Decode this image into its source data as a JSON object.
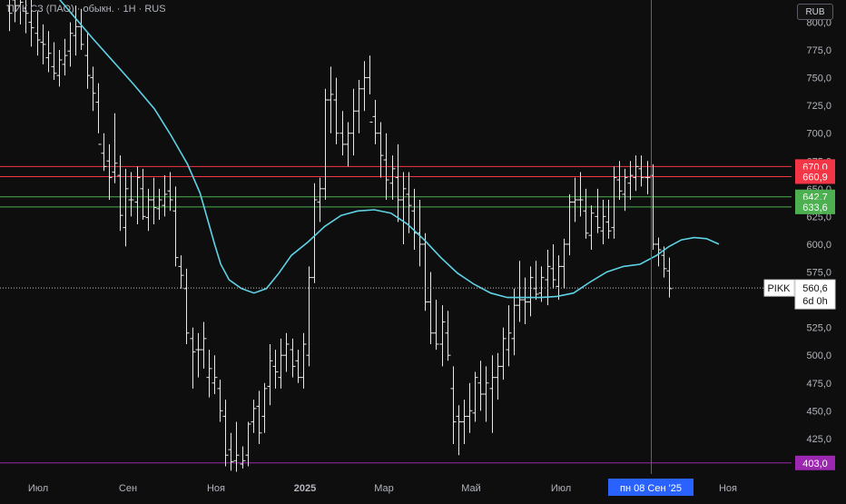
{
  "header": {
    "title": "ПИК СЗ (ПАО) · обыкн. · 1Н · RUS"
  },
  "currency": "RUB",
  "colors": {
    "background": "#0e0e0e",
    "bars": "#e8e8e8",
    "moving_average": "#5fd3e6",
    "resistance": "#f23645",
    "support": "#4caf50",
    "purple_level": "#9c27b0",
    "crosshair": "#3d5afe",
    "date_badge": "#2962ff"
  },
  "chart_data": {
    "type": "ohlc",
    "y_axis": {
      "range": [
        393,
        820
      ],
      "ticks": [
        800,
        775,
        750,
        725,
        700,
        675,
        650,
        625,
        600,
        575,
        550,
        525,
        500,
        475,
        450,
        425
      ],
      "tick_labels": [
        "800,0",
        "775,0",
        "750,0",
        "725,0",
        "700,0",
        "675,0",
        "650,0",
        "625,0",
        "600,0",
        "575,0",
        "550,0",
        "525,0",
        "500,0",
        "475,0",
        "450,0",
        "425,0"
      ]
    },
    "x_axis": {
      "labels": [
        "Июл",
        "Сен",
        "Ноя",
        "2025",
        "Мар",
        "Май",
        "Июл",
        "Ноя"
      ],
      "bold_label": "2025"
    },
    "symbol": "PIKK",
    "last_price": {
      "value": 560.6,
      "label": "560,6",
      "countdown": "6d 0h"
    },
    "crosshair_date": "пн 08 Сен '25",
    "horizontal_levels": [
      {
        "value": 824,
        "kind": "purple_level",
        "label": ""
      },
      {
        "value": 670.0,
        "kind": "resistance",
        "label": "670,0"
      },
      {
        "value": 660.9,
        "kind": "resistance",
        "label": "660,9"
      },
      {
        "value": 642.7,
        "kind": "support",
        "label": "642,7"
      },
      {
        "value": 633.6,
        "kind": "support",
        "label": "633,6"
      },
      {
        "value": 403.0,
        "kind": "purple_level",
        "label": "403,0"
      }
    ],
    "bars": [
      [
        815,
        832,
        792,
        808
      ],
      [
        820,
        832,
        800,
        815
      ],
      [
        815,
        830,
        798,
        818
      ],
      [
        810,
        825,
        790,
        808
      ],
      [
        800,
        820,
        778,
        795
      ],
      [
        790,
        810,
        770,
        784
      ],
      [
        782,
        798,
        762,
        780
      ],
      [
        768,
        792,
        755,
        772
      ],
      [
        760,
        782,
        748,
        754
      ],
      [
        752,
        775,
        742,
        766
      ],
      [
        762,
        785,
        752,
        770
      ],
      [
        774,
        800,
        760,
        790
      ],
      [
        788,
        815,
        770,
        796
      ],
      [
        796,
        812,
        775,
        780
      ],
      [
        770,
        790,
        740,
        752
      ],
      [
        750,
        760,
        720,
        736
      ],
      [
        728,
        745,
        700,
        690
      ],
      [
        682,
        700,
        666,
        670
      ],
      [
        675,
        690,
        640,
        660
      ],
      [
        665,
        718,
        655,
        673
      ],
      [
        662,
        680,
        612,
        626
      ],
      [
        615,
        668,
        598,
        650
      ],
      [
        640,
        665,
        625,
        640
      ],
      [
        638,
        670,
        618,
        660
      ],
      [
        650,
        668,
        622,
        625
      ],
      [
        624,
        650,
        612,
        640
      ],
      [
        640,
        660,
        618,
        633
      ],
      [
        632,
        650,
        622,
        640
      ],
      [
        635,
        662,
        625,
        645
      ],
      [
        648,
        665,
        630,
        640
      ],
      [
        630,
        652,
        580,
        588
      ],
      [
        580,
        590,
        560,
        572
      ],
      [
        560,
        578,
        510,
        520
      ],
      [
        515,
        525,
        470,
        503
      ],
      [
        505,
        520,
        480,
        505
      ],
      [
        505,
        530,
        488,
        515
      ],
      [
        480,
        505,
        462,
        488
      ],
      [
        475,
        500,
        465,
        480
      ],
      [
        470,
        478,
        440,
        450
      ],
      [
        445,
        460,
        400,
        410
      ],
      [
        415,
        430,
        396,
        404
      ],
      [
        405,
        440,
        395,
        410
      ],
      [
        402,
        418,
        398,
        405
      ],
      [
        410,
        440,
        400,
        438
      ],
      [
        440,
        460,
        430,
        452
      ],
      [
        454,
        468,
        420,
        430
      ],
      [
        445,
        475,
        430,
        470
      ],
      [
        472,
        510,
        455,
        495
      ],
      [
        490,
        505,
        470,
        485
      ],
      [
        480,
        515,
        470,
        500
      ],
      [
        500,
        520,
        485,
        510
      ],
      [
        505,
        515,
        480,
        490
      ],
      [
        495,
        505,
        475,
        480
      ],
      [
        480,
        520,
        470,
        510
      ],
      [
        500,
        580,
        490,
        570
      ],
      [
        570,
        655,
        565,
        640
      ],
      [
        638,
        660,
        620,
        650
      ],
      [
        650,
        740,
        640,
        730
      ],
      [
        730,
        760,
        700,
        735
      ],
      [
        730,
        750,
        690,
        700
      ],
      [
        700,
        720,
        680,
        690
      ],
      [
        690,
        710,
        670,
        700
      ],
      [
        700,
        740,
        680,
        720
      ],
      [
        720,
        748,
        700,
        740
      ],
      [
        740,
        765,
        720,
        750
      ],
      [
        750,
        770,
        735,
        710
      ],
      [
        715,
        730,
        690,
        700
      ],
      [
        700,
        710,
        660,
        680
      ],
      [
        676,
        700,
        640,
        658
      ],
      [
        655,
        680,
        640,
        668
      ],
      [
        660,
        690,
        620,
        640
      ],
      [
        640,
        665,
        600,
        650
      ],
      [
        645,
        665,
        610,
        635
      ],
      [
        630,
        650,
        595,
        610
      ],
      [
        610,
        640,
        580,
        600
      ],
      [
        600,
        610,
        540,
        548
      ],
      [
        548,
        575,
        510,
        520
      ],
      [
        520,
        550,
        505,
        510
      ],
      [
        510,
        545,
        490,
        530
      ],
      [
        520,
        540,
        495,
        500
      ],
      [
        470,
        490,
        420,
        440
      ],
      [
        445,
        455,
        410,
        440
      ],
      [
        440,
        460,
        420,
        445
      ],
      [
        445,
        475,
        430,
        450
      ],
      [
        448,
        485,
        440,
        480
      ],
      [
        475,
        495,
        450,
        465
      ],
      [
        465,
        490,
        440,
        475
      ],
      [
        470,
        500,
        430,
        480
      ],
      [
        480,
        502,
        460,
        490
      ],
      [
        490,
        525,
        478,
        515
      ],
      [
        505,
        545,
        490,
        520
      ],
      [
        515,
        560,
        500,
        545
      ],
      [
        545,
        585,
        530,
        550
      ],
      [
        550,
        570,
        528,
        548
      ],
      [
        548,
        580,
        535,
        570
      ],
      [
        560,
        585,
        550,
        555
      ],
      [
        556,
        580,
        548,
        570
      ],
      [
        568,
        595,
        545,
        580
      ],
      [
        578,
        600,
        560,
        568
      ],
      [
        562,
        590,
        550,
        580
      ],
      [
        580,
        605,
        560,
        600
      ],
      [
        600,
        645,
        590,
        638
      ],
      [
        638,
        660,
        620,
        640
      ],
      [
        640,
        665,
        625,
        640
      ],
      [
        630,
        650,
        605,
        610
      ],
      [
        608,
        635,
        595,
        628
      ],
      [
        625,
        650,
        610,
        615
      ],
      [
        612,
        640,
        600,
        625
      ],
      [
        620,
        640,
        605,
        612
      ],
      [
        615,
        670,
        605,
        660
      ],
      [
        658,
        675,
        640,
        648
      ],
      [
        645,
        668,
        630,
        660
      ],
      [
        655,
        675,
        640,
        662
      ],
      [
        660,
        680,
        648,
        670
      ],
      [
        668,
        680,
        652,
        660
      ],
      [
        660,
        675,
        645,
        660
      ],
      [
        662,
        672,
        595,
        600
      ],
      [
        600,
        606,
        580,
        595
      ],
      [
        590,
        598,
        570,
        578
      ],
      [
        576,
        588,
        552,
        560
      ]
    ],
    "moving_average": [
      [
        0,
        868
      ],
      [
        10,
        850
      ],
      [
        20,
        830
      ],
      [
        30,
        808
      ],
      [
        40,
        786
      ],
      [
        50,
        765
      ],
      [
        60,
        744
      ],
      [
        70,
        722
      ],
      [
        78,
        698
      ],
      [
        86,
        672
      ],
      [
        92,
        646
      ],
      [
        96,
        620
      ],
      [
        99,
        600
      ],
      [
        102,
        582
      ],
      [
        106,
        568
      ],
      [
        112,
        560
      ],
      [
        118,
        556
      ],
      [
        124,
        560
      ],
      [
        130,
        574
      ],
      [
        136,
        590
      ],
      [
        144,
        602
      ],
      [
        152,
        616
      ],
      [
        160,
        626
      ],
      [
        168,
        630
      ],
      [
        176,
        631
      ],
      [
        184,
        628
      ],
      [
        192,
        618
      ],
      [
        200,
        604
      ],
      [
        208,
        588
      ],
      [
        216,
        574
      ],
      [
        224,
        564
      ],
      [
        232,
        556
      ],
      [
        240,
        552
      ],
      [
        248,
        552
      ],
      [
        256,
        552
      ],
      [
        264,
        553
      ],
      [
        272,
        556
      ],
      [
        280,
        566
      ],
      [
        288,
        575
      ],
      [
        296,
        580
      ],
      [
        304,
        582
      ],
      [
        312,
        590
      ],
      [
        318,
        598
      ],
      [
        324,
        604
      ],
      [
        330,
        606
      ],
      [
        336,
        605
      ],
      [
        342,
        600
      ]
    ]
  }
}
